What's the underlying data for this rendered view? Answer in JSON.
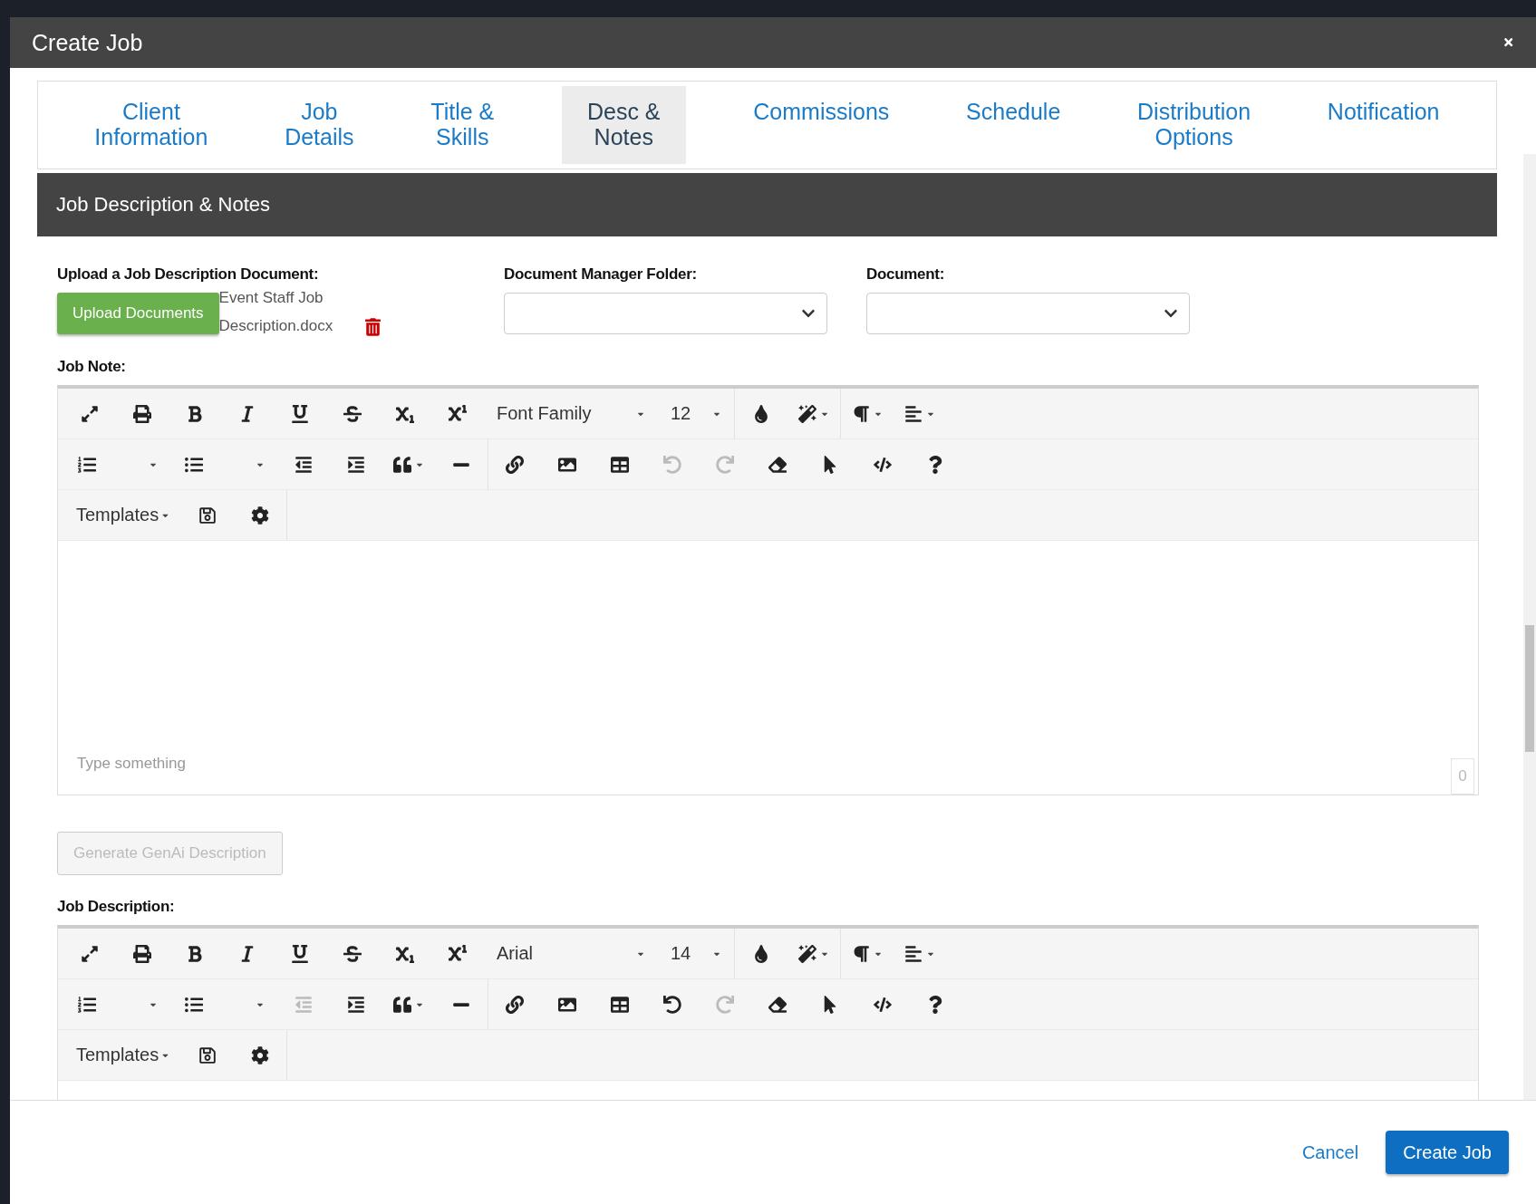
{
  "window": {
    "title": "Create Job"
  },
  "tabs": [
    {
      "label": "Client\nInformation",
      "selected": false
    },
    {
      "label": "Job\nDetails",
      "selected": false
    },
    {
      "label": "Title &\nSkills",
      "selected": false
    },
    {
      "label": "Desc &\nNotes",
      "selected": true
    },
    {
      "label": "Commissions",
      "selected": false
    },
    {
      "label": "Schedule",
      "selected": false
    },
    {
      "label": "Distribution\nOptions",
      "selected": false
    },
    {
      "label": "Notification",
      "selected": false
    }
  ],
  "section": {
    "title": "Job Description & Notes",
    "upload": {
      "label": "Upload a Job Description Document:",
      "button": "Upload Documents",
      "file": "Event Staff Job Description.docx"
    },
    "folder": {
      "label": "Document Manager Folder:"
    },
    "document": {
      "label": "Document:"
    },
    "job_note": {
      "label": "Job Note:",
      "font_family": "Font Family",
      "font_size": "12",
      "templates": "Templates",
      "placeholder": "Type something",
      "count": "0",
      "outdent_disabled": false,
      "undo_disabled": true,
      "redo_disabled": true
    },
    "generate": {
      "label": "Generate GenAi Description",
      "disabled": true
    },
    "job_description": {
      "label": "Job Description:",
      "font_family": "Arial",
      "font_size": "14",
      "templates": "Templates",
      "outdent_disabled": true,
      "undo_disabled": false,
      "redo_disabled": true
    }
  },
  "footer": {
    "cancel": "Cancel",
    "submit": "Create Job"
  }
}
